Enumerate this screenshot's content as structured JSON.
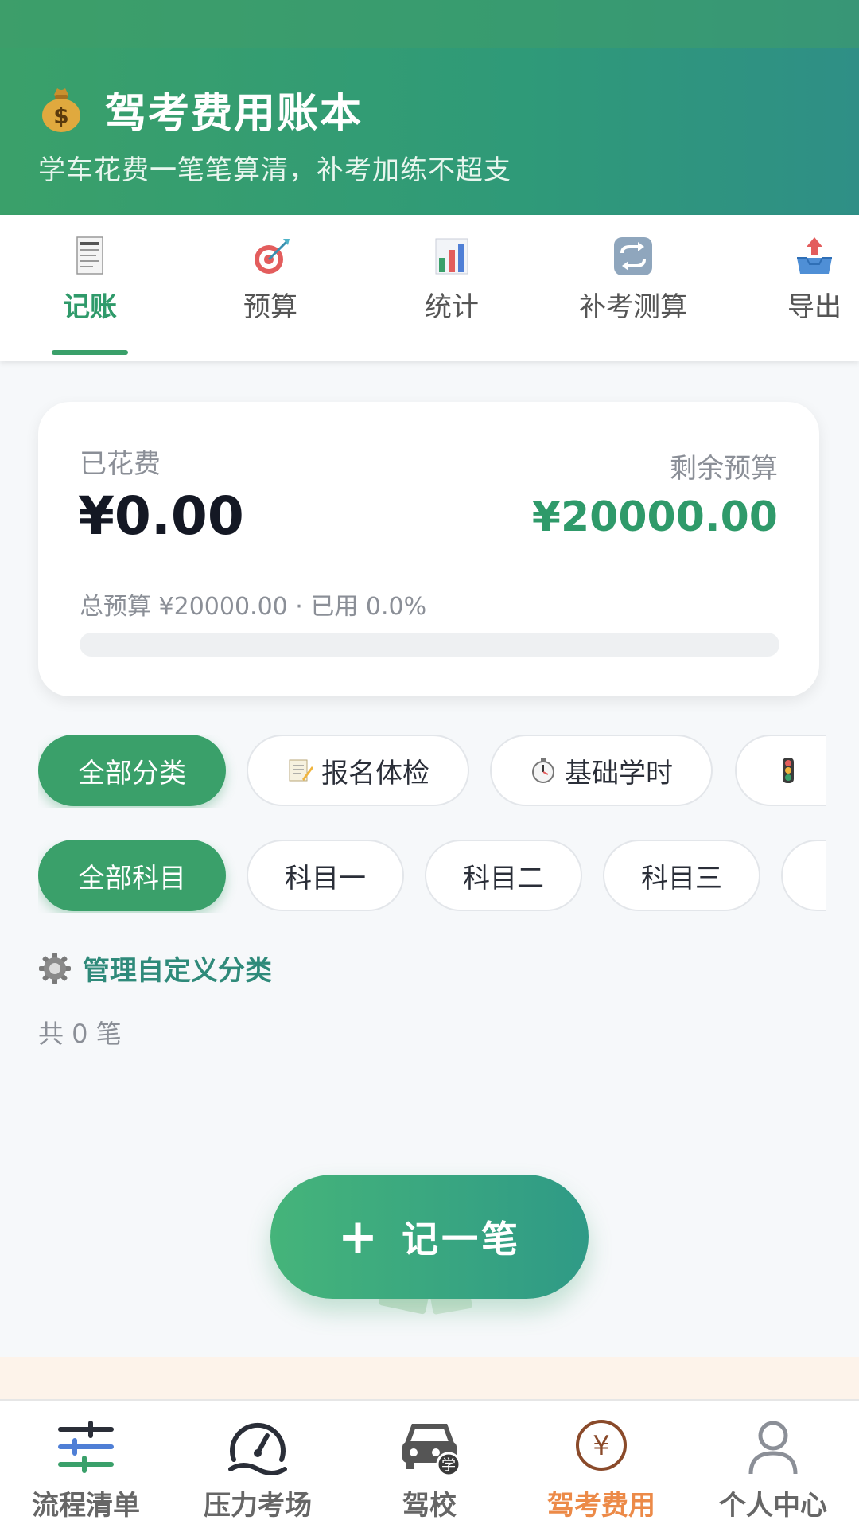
{
  "header": {
    "title": "驾考费用账本",
    "subtitle": "学车花费一笔笔算清，补考加练不超支"
  },
  "tabs": [
    {
      "label": "记账",
      "icon": "receipt-icon",
      "active": true
    },
    {
      "label": "预算",
      "icon": "target-icon",
      "active": false
    },
    {
      "label": "统计",
      "icon": "bar-chart-icon",
      "active": false
    },
    {
      "label": "补考测算",
      "icon": "repeat-icon",
      "active": false
    },
    {
      "label": "导出",
      "icon": "export-tray-icon",
      "active": false
    }
  ],
  "summary": {
    "spent_label": "已花费",
    "spent_value": "¥0.00",
    "remain_label": "剩余预算",
    "remain_value": "¥20000.00",
    "detail": "总预算 ¥20000.00 · 已用 0.0%",
    "used_fraction": 0.0
  },
  "category_chips": [
    {
      "label": "全部分类",
      "active": true,
      "icon": ""
    },
    {
      "label": "报名体检",
      "active": false,
      "icon": "memo-icon"
    },
    {
      "label": "基础学时",
      "active": false,
      "icon": "stopwatch-icon"
    },
    {
      "label": "",
      "active": false,
      "icon": "traffic-light-icon"
    }
  ],
  "subject_chips": [
    {
      "label": "全部科目",
      "active": true
    },
    {
      "label": "科目一",
      "active": false
    },
    {
      "label": "科目二",
      "active": false
    },
    {
      "label": "科目三",
      "active": false
    },
    {
      "label": "",
      "active": false
    }
  ],
  "manage": {
    "label": "管理自定义分类"
  },
  "count_text": "共 0 笔",
  "fab": {
    "label": "记一笔",
    "plus": "+"
  },
  "bottom_nav": [
    {
      "label": "流程清单",
      "icon": "checklist-sliders-icon",
      "active": false
    },
    {
      "label": "压力考场",
      "icon": "speedometer-icon",
      "active": false
    },
    {
      "label": "驾校",
      "icon": "car-school-icon",
      "active": false
    },
    {
      "label": "驾考费用",
      "icon": "yen-coin-icon",
      "active": true
    },
    {
      "label": "个人中心",
      "icon": "person-icon",
      "active": false
    }
  ],
  "colors": {
    "primary": "#3aa06a",
    "accent_orange": "#ec8a48",
    "text_dark": "#141824",
    "muted": "#8b8f97"
  }
}
